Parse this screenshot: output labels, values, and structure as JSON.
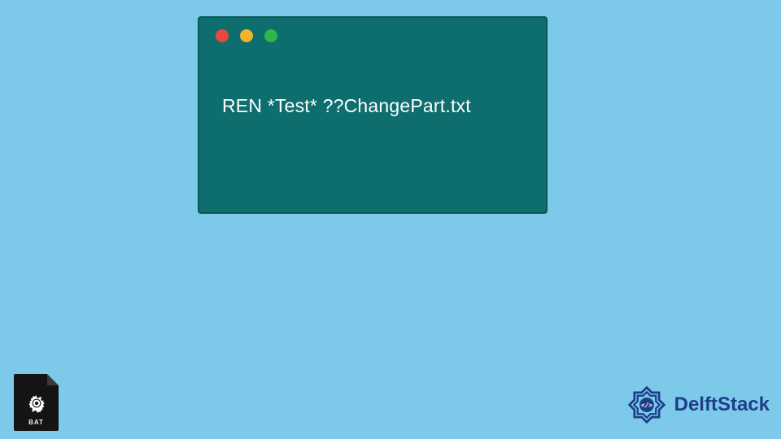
{
  "window": {
    "code": "REN *Test* ??ChangePart.txt",
    "lights": {
      "red": "#e9493d",
      "yellow": "#f0b429",
      "green": "#2fb84a"
    }
  },
  "bat_icon": {
    "label": "BAT"
  },
  "brand": {
    "text": "DelftStack"
  }
}
